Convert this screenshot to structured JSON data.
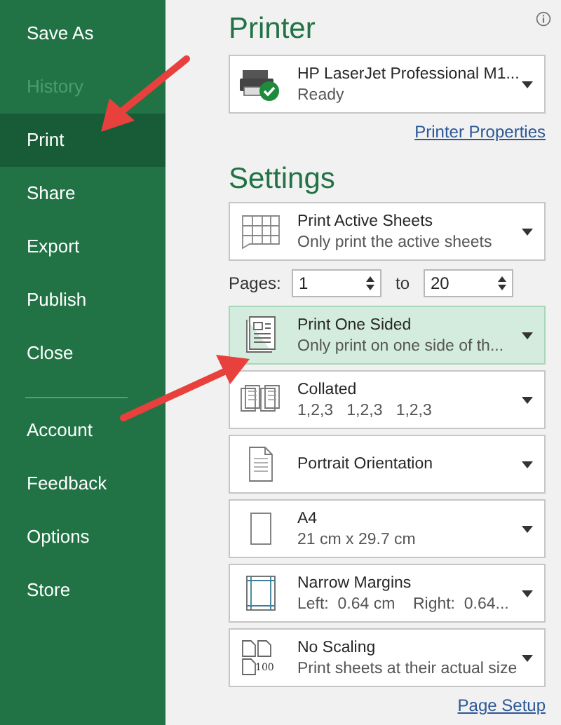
{
  "sidebar": {
    "items": [
      {
        "label": "Save As",
        "selected": false,
        "disabled": false
      },
      {
        "label": "History",
        "selected": false,
        "disabled": true
      },
      {
        "label": "Print",
        "selected": true,
        "disabled": false
      },
      {
        "label": "Share",
        "selected": false,
        "disabled": false
      },
      {
        "label": "Export",
        "selected": false,
        "disabled": false
      },
      {
        "label": "Publish",
        "selected": false,
        "disabled": false
      },
      {
        "label": "Close",
        "selected": false,
        "disabled": false
      }
    ],
    "items_lower": [
      {
        "label": "Account",
        "selected": false,
        "disabled": false
      },
      {
        "label": "Feedback",
        "selected": false,
        "disabled": false
      },
      {
        "label": "Options",
        "selected": false,
        "disabled": false
      },
      {
        "label": "Store",
        "selected": false,
        "disabled": false
      }
    ]
  },
  "printer": {
    "heading": "Printer",
    "name": "HP LaserJet Professional M1...",
    "status": "Ready",
    "link": "Printer Properties"
  },
  "settings": {
    "heading": "Settings",
    "items": [
      {
        "kind": "sheets",
        "title": "Print Active Sheets",
        "detail": "Only print the active sheets",
        "highlighted": false
      },
      {
        "kind": "pages",
        "label": "Pages:",
        "from": "1",
        "to_label": "to",
        "to": "20"
      },
      {
        "kind": "sides",
        "title": "Print One Sided",
        "detail": "Only print on one side of th...",
        "highlighted": true
      },
      {
        "kind": "collate",
        "title": "Collated",
        "detail": "1,2,3   1,2,3   1,2,3",
        "highlighted": false
      },
      {
        "kind": "orientation",
        "title": "Portrait Orientation",
        "highlighted": false
      },
      {
        "kind": "paper",
        "title": "A4",
        "detail": "21 cm x 29.7 cm",
        "highlighted": false
      },
      {
        "kind": "margins",
        "title": "Narrow Margins",
        "detail": "Left:  0.64 cm    Right:  0.64...",
        "highlighted": false
      },
      {
        "kind": "scaling",
        "title": "No Scaling",
        "detail": "Print sheets at their actual size",
        "highlighted": false,
        "icon_text": "100"
      }
    ],
    "link": "Page Setup"
  }
}
